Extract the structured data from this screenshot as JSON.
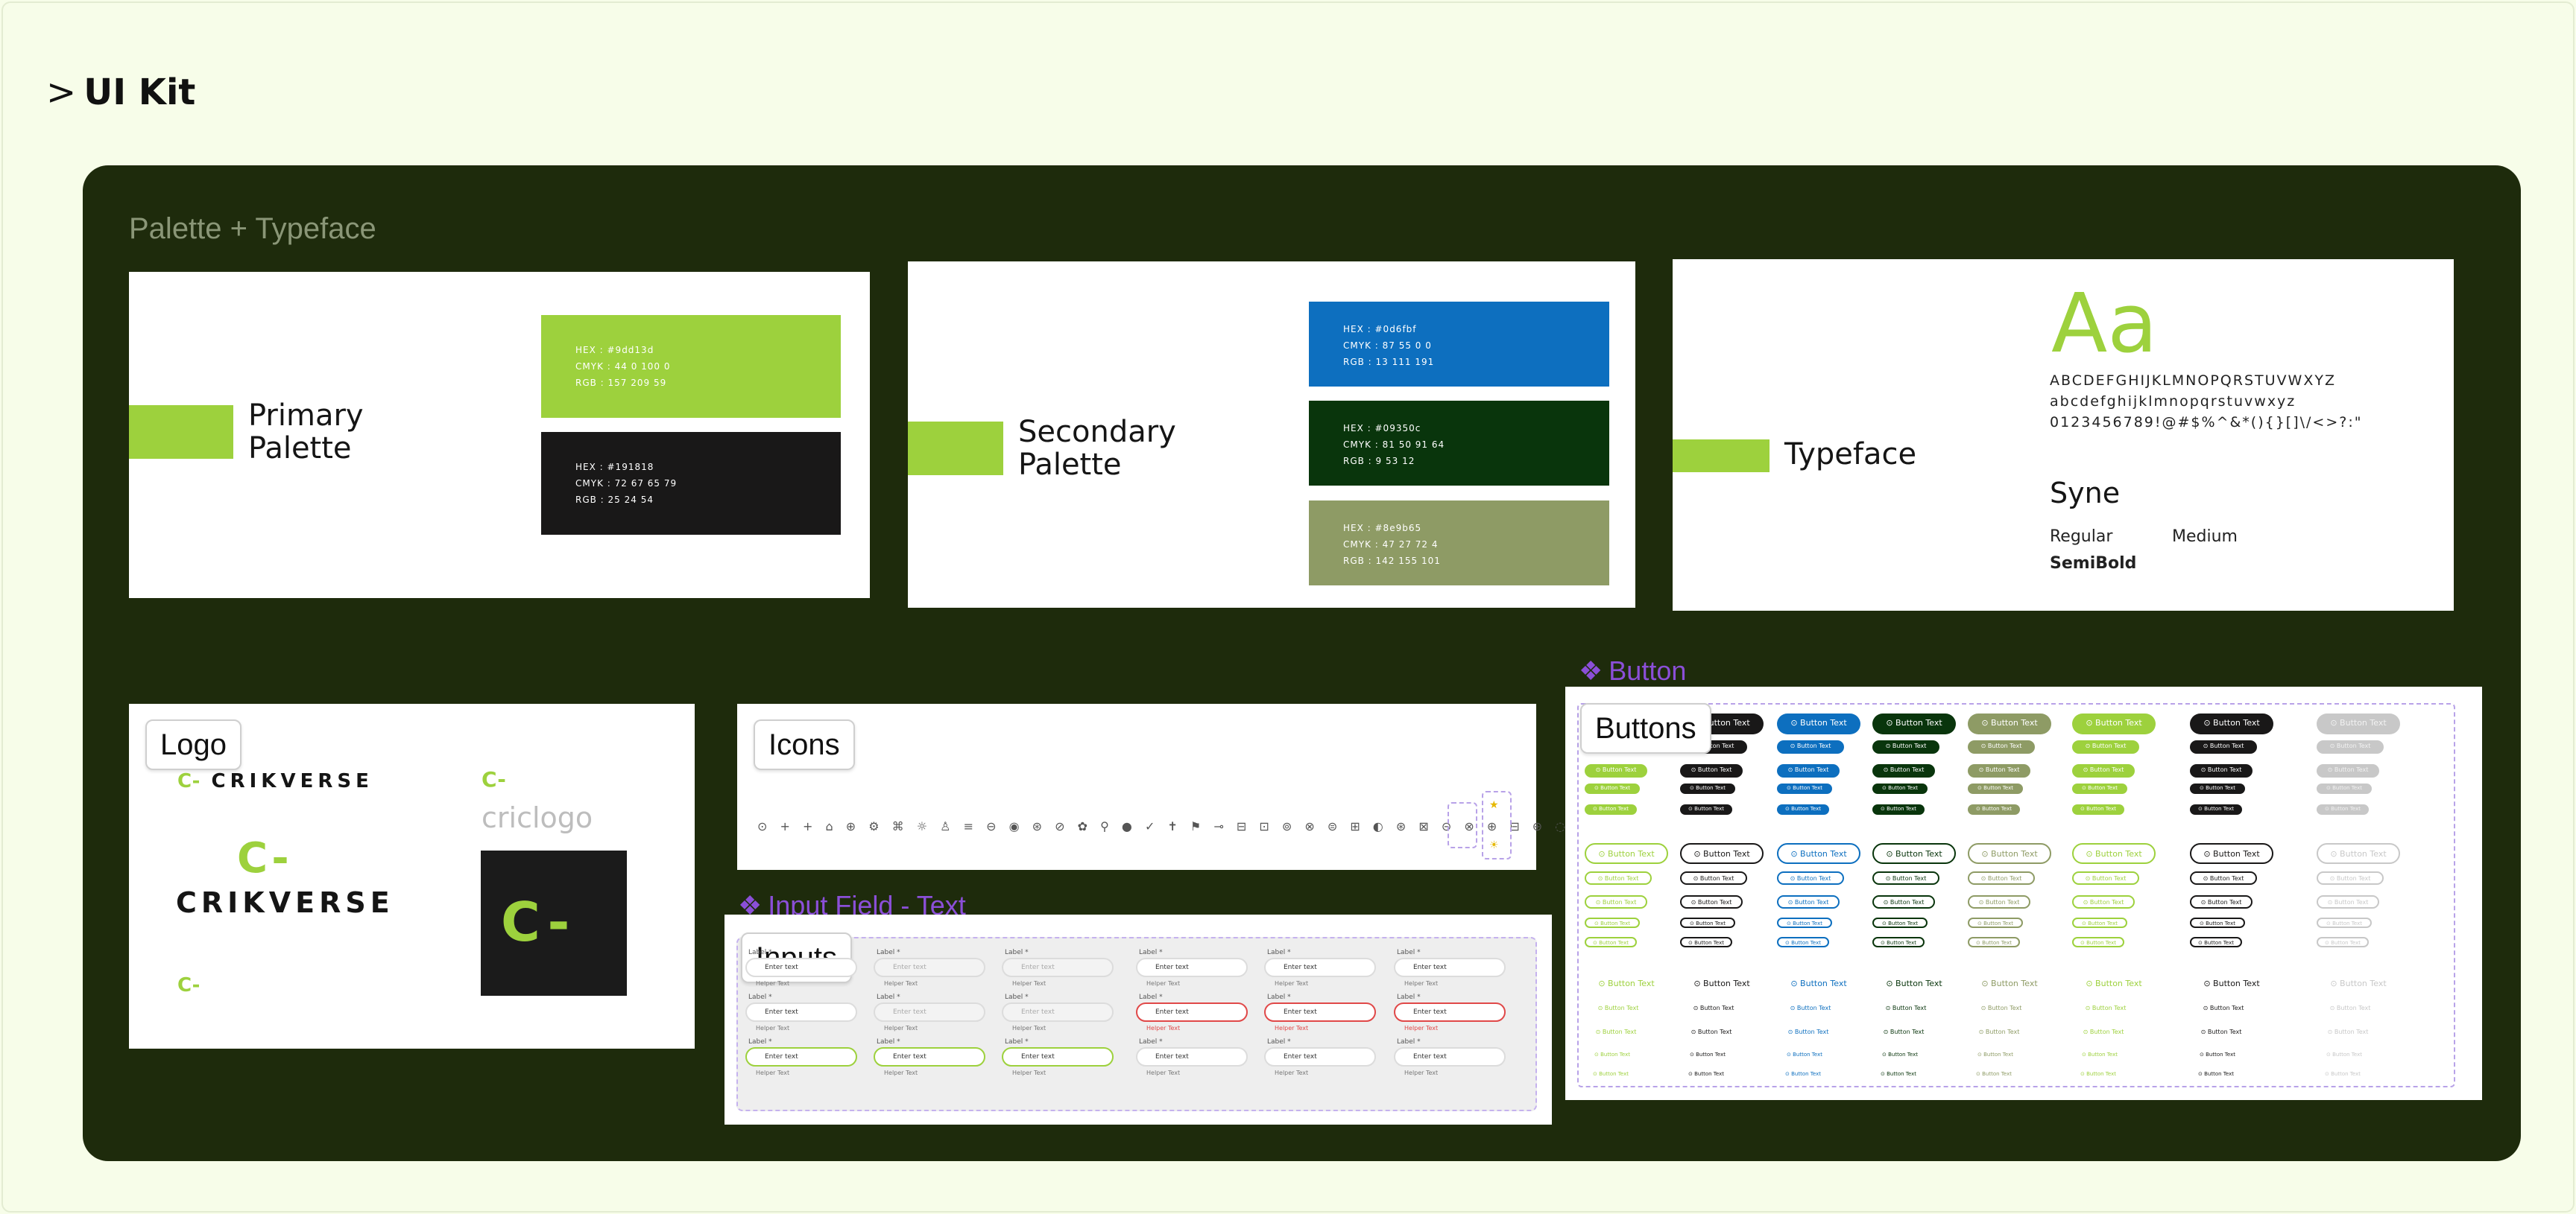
{
  "page": {
    "title": "UI Kit",
    "chevron": ">"
  },
  "board": {
    "section_label": "Palette + Typeface"
  },
  "primary": {
    "title_line1": "Primary",
    "title_line2": "Palette",
    "swatches": [
      {
        "hex": "HEX : #9dd13d",
        "cmyk": "CMYK : 44 0 100 0",
        "rgb": "RGB : 157 209 59",
        "color": "#9dd13d"
      },
      {
        "hex": "HEX : #191818",
        "cmyk": "CMYK : 72 67 65 79",
        "rgb": "RGB : 25 24 54",
        "color": "#191818"
      }
    ]
  },
  "secondary": {
    "title_line1": "Secondary",
    "title_line2": "Palette",
    "swatches": [
      {
        "hex": "HEX : #0d6fbf",
        "cmyk": "CMYK : 87 55 0 0",
        "rgb": "RGB : 13 111 191",
        "color": "#0d6fbf"
      },
      {
        "hex": "HEX : #09350c",
        "cmyk": "CMYK : 81 50 91 64",
        "rgb": "RGB : 9 53 12",
        "color": "#09350c"
      },
      {
        "hex": "HEX : #8e9b65",
        "cmyk": "CMYK : 47 27 72 4",
        "rgb": "RGB : 142 155 101",
        "color": "#8e9b65"
      }
    ]
  },
  "typeface": {
    "title": "Typeface",
    "sample": "Aa",
    "uppercase": "ABCDEFGHIJKLMNOPQRSTUVWXYZ",
    "lowercase": "abcdefghijklmnopqrstuvwxyz",
    "numbers": "0123456789!@#$%^&*(){}[]\\/<>?:\"",
    "font_name": "Syne",
    "weights": [
      "Regular",
      "Medium",
      "SemiBold"
    ]
  },
  "logo": {
    "tag": "Logo",
    "wordmark": "CRIKVERSE",
    "symbol": "C-",
    "alt_label": "criclogo"
  },
  "icons": {
    "tag": "Icons",
    "glyphs": "⊙ + + ⌂ ⊕ ⚙ ⌘ ☼ ♙ ≡ ⊖ ◉ ⊛ ⊘ ✿ ⚲ ● ✓ ✝ ⚑ ⊸ ⊟ ⊡ ⊚ ⊗ ⊜ ⊞ ◐ ⊛ ⊠ ⊝ ⊗ ⊕ ⊟ ⊕ ◌ ↺ ⊿ ⚠ ✓ ⚠ ◉ ● ◉ ◉ ‹ › ⌄ ··· ⋄ ◂ ◉ ◇ ↻ ⌀ ⊘"
  },
  "inputs": {
    "tag": "Inputs",
    "component_label": "Input Field - Text",
    "label": "Label",
    "placeholder": "Enter text",
    "helper": "Helper Text"
  },
  "buttons": {
    "tag": "Buttons",
    "component_label": "Button",
    "label": "Button Text",
    "colors": [
      "#9dd13d",
      "#191818",
      "#0d6fbf",
      "#09350c",
      "#8e9b65",
      "#9dd13d",
      "#191818",
      "#c8c8c8"
    ]
  }
}
